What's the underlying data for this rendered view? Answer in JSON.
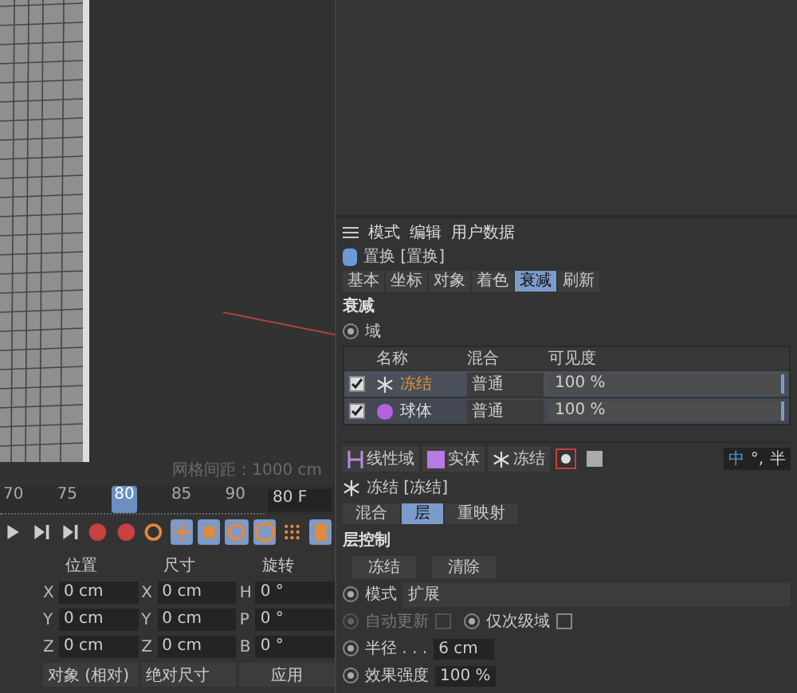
{
  "viewport": {
    "grid_spacing": "网格间距：1000 cm"
  },
  "timeline": {
    "ticks": [
      "70",
      "75",
      "80",
      "85",
      "90"
    ],
    "frame": "80 F"
  },
  "coordinates": {
    "headers": [
      "位置",
      "尺寸",
      "旋转"
    ],
    "rows": [
      [
        {
          "axis": "X",
          "value": "0 cm"
        },
        {
          "axis": "X",
          "value": "0 cm"
        },
        {
          "axis": "H",
          "value": "0 °"
        }
      ],
      [
        {
          "axis": "Y",
          "value": "0 cm"
        },
        {
          "axis": "Y",
          "value": "0 cm"
        },
        {
          "axis": "P",
          "value": "0 °"
        }
      ],
      [
        {
          "axis": "Z",
          "value": "0 cm"
        },
        {
          "axis": "Z",
          "value": "0 cm"
        },
        {
          "axis": "B",
          "value": "0 °"
        }
      ]
    ],
    "space": "对象 (相对)",
    "size_mode": "绝对尺寸",
    "apply": "应用"
  },
  "attributes": {
    "menu": [
      "模式",
      "编辑",
      "用户数据"
    ],
    "object": "置换 [置换]",
    "tabs": [
      {
        "label": "基本",
        "selected": false
      },
      {
        "label": "坐标",
        "selected": false
      },
      {
        "label": "对象",
        "selected": false
      },
      {
        "label": "着色",
        "selected": false
      },
      {
        "label": "衰减",
        "selected": true
      },
      {
        "label": "刷新",
        "selected": false
      }
    ],
    "section": "衰减",
    "field_radio": "域",
    "columns": [
      "名称",
      "混合",
      "可见度"
    ],
    "rows": [
      {
        "kind": "freeze",
        "name": "冻结",
        "selected": true,
        "checked": true,
        "blend": "普通",
        "visibility": "100 %"
      },
      {
        "kind": "sphere",
        "name": "球体",
        "selected": false,
        "checked": true,
        "blend": "普通",
        "visibility": "100 %"
      }
    ]
  },
  "field_toolbar": [
    {
      "kind": "linear",
      "label": "线性域"
    },
    {
      "kind": "solid",
      "label": "实体"
    },
    {
      "kind": "freeze",
      "label": "冻结"
    }
  ],
  "ime": {
    "mode": "中",
    "punct": "°,",
    "width": "半"
  },
  "layer": {
    "object": "冻结 [冻结]",
    "tabs": [
      {
        "label": "混合",
        "selected": false
      },
      {
        "label": "层",
        "selected": true
      },
      {
        "label": "重映射",
        "selected": false
      }
    ],
    "section": "层控制",
    "buttons": [
      "冻结",
      "清除"
    ],
    "params": [
      {
        "kind": "dropdown",
        "label": "模式",
        "value": "扩展"
      },
      {
        "kind": "checks",
        "items": [
          {
            "label": "自动更新",
            "checked": false,
            "disabled": true
          },
          {
            "label": "仅次级域",
            "checked": false,
            "disabled": false
          }
        ]
      },
      {
        "kind": "number",
        "label": "半径 . . .",
        "value": "6 cm"
      },
      {
        "kind": "number",
        "label": "效果强度",
        "value": "100 %"
      }
    ]
  }
}
